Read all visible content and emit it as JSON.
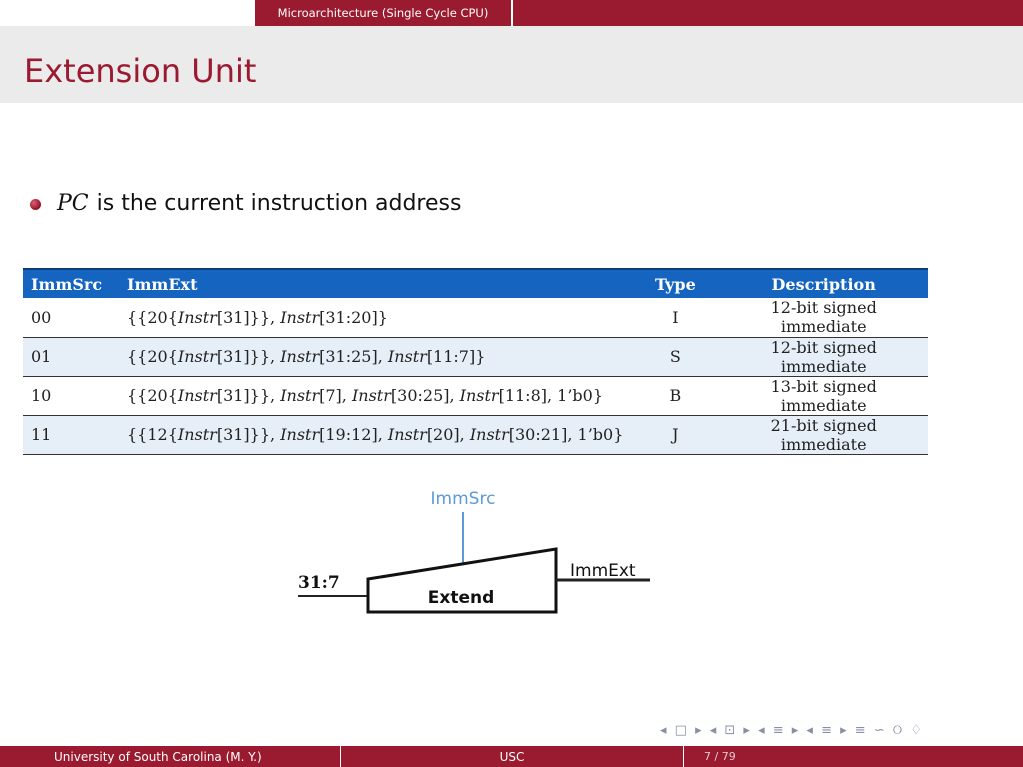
{
  "header": {
    "section": "Microarchitecture (Single Cycle CPU)"
  },
  "slide": {
    "title": "Extension Unit",
    "bullet": {
      "variable": "PC",
      "text": "is the current instruction address"
    }
  },
  "table": {
    "headers": [
      "ImmSrc",
      "ImmExt",
      "Type",
      "Description"
    ],
    "rows": [
      {
        "immsrc": "00",
        "ext": [
          {
            "t": "{{20{"
          },
          {
            "t": "Instr",
            "i": true
          },
          {
            "t": "[31]}}, "
          },
          {
            "t": "Instr",
            "i": true
          },
          {
            "t": "[31:20]}"
          }
        ],
        "type": "I",
        "desc": "12-bit signed immediate"
      },
      {
        "immsrc": "01",
        "ext": [
          {
            "t": "{{20{"
          },
          {
            "t": "Instr",
            "i": true
          },
          {
            "t": "[31]}}, "
          },
          {
            "t": "Instr",
            "i": true
          },
          {
            "t": "[31:25], "
          },
          {
            "t": "Instr",
            "i": true
          },
          {
            "t": "[11:7]}"
          }
        ],
        "type": "S",
        "desc": "12-bit signed immediate"
      },
      {
        "immsrc": "10",
        "ext": [
          {
            "t": "{{20{"
          },
          {
            "t": "Instr",
            "i": true
          },
          {
            "t": "[31]}}, "
          },
          {
            "t": "Instr",
            "i": true
          },
          {
            "t": "[7], "
          },
          {
            "t": "Instr",
            "i": true
          },
          {
            "t": "[30:25], "
          },
          {
            "t": "Instr",
            "i": true
          },
          {
            "t": "[11:8], 1’b0}"
          }
        ],
        "type": "B",
        "desc": "13-bit signed immediate"
      },
      {
        "immsrc": "11",
        "ext": [
          {
            "t": "{{12{"
          },
          {
            "t": "Instr",
            "i": true
          },
          {
            "t": "[31]}}, "
          },
          {
            "t": "Instr",
            "i": true
          },
          {
            "t": "[19:12], "
          },
          {
            "t": "Instr",
            "i": true
          },
          {
            "t": "[20], "
          },
          {
            "t": "Instr",
            "i": true
          },
          {
            "t": "[30:21], 1’b0}"
          }
        ],
        "type": "J",
        "desc": "21-bit signed immediate"
      }
    ]
  },
  "diagram": {
    "control_label": "ImmSrc",
    "input_label": "31:7",
    "block_label": "Extend",
    "output_label": "ImmExt",
    "control_color": "#5b9bd5"
  },
  "nav": {
    "icons": "◂ □ ▸ ◂ ⊡ ▸ ◂ ≡ ▸ ◂ ≡ ▸   ≡   ∽ ୦ ♢"
  },
  "footer": {
    "left": "University of South Carolina  (M. Y.)",
    "center": "USC",
    "page": "7 / 79"
  },
  "colors": {
    "brand": "#9a1a30",
    "table_header": "#1565c0",
    "row_alt": "#e6eef8"
  }
}
